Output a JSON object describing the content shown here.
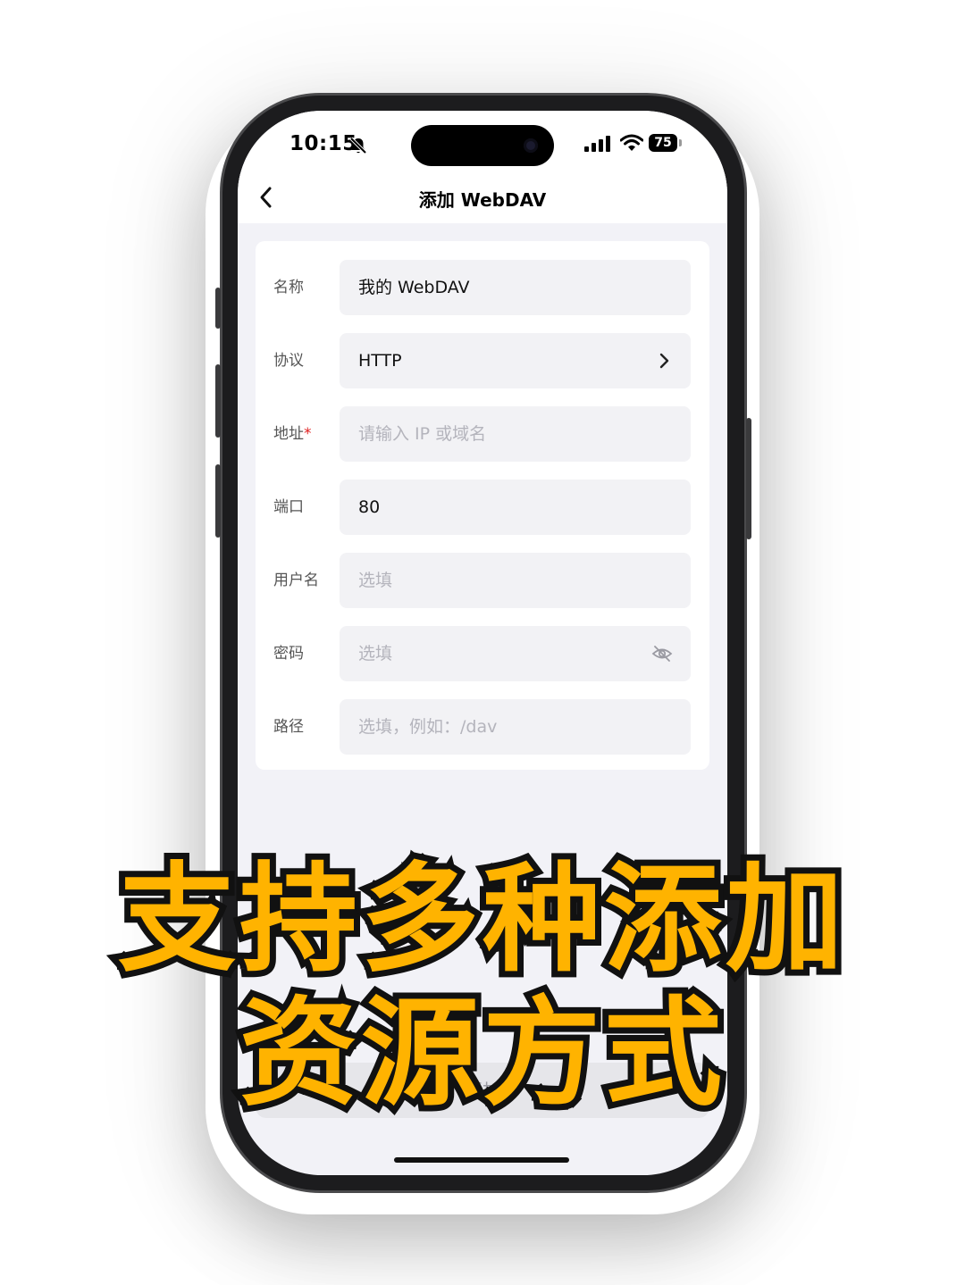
{
  "status_bar": {
    "time": "10:15",
    "battery": "75",
    "icons": [
      "bell-muted-icon",
      "signal-icon",
      "wifi-icon",
      "battery-icon"
    ]
  },
  "nav": {
    "title": "添加 WebDAV",
    "back_icon": "chevron-left-icon"
  },
  "form": {
    "rows": [
      {
        "label": "名称",
        "value": "我的 WebDAV",
        "placeholder": "",
        "required": false,
        "trailing_icon": ""
      },
      {
        "label": "协议",
        "value": "HTTP",
        "placeholder": "",
        "required": false,
        "trailing_icon": "chevron-right-icon"
      },
      {
        "label": "地址",
        "value": "",
        "placeholder": "请输入 IP 或域名",
        "required": true,
        "trailing_icon": ""
      },
      {
        "label": "端口",
        "value": "80",
        "placeholder": "",
        "required": false,
        "trailing_icon": ""
      },
      {
        "label": "用户名",
        "value": "",
        "placeholder": "选填",
        "required": false,
        "trailing_icon": ""
      },
      {
        "label": "密码",
        "value": "",
        "placeholder": "选填",
        "required": false,
        "trailing_icon": "eye-off-icon"
      },
      {
        "label": "路径",
        "value": "",
        "placeholder": "选填，例如：/dav",
        "required": false,
        "trailing_icon": ""
      }
    ],
    "required_mark": "*"
  },
  "bottom_button": {
    "label": "添加"
  },
  "caption": {
    "line1": "支持多种添加",
    "line2": "资源方式",
    "fill_color": "#ffb300",
    "stroke_color": "#111111"
  }
}
